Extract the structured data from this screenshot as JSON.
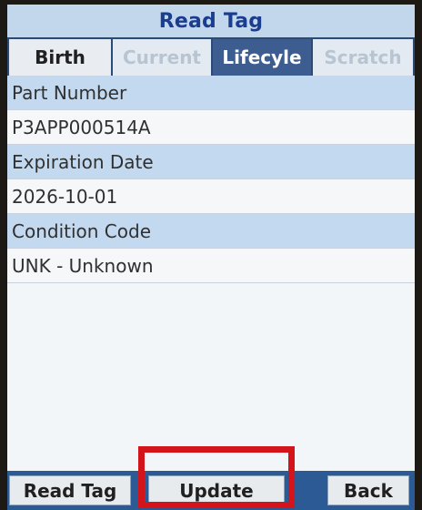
{
  "header": {
    "title": "Read Tag"
  },
  "tabs": [
    {
      "label": "Birth",
      "state": "normal"
    },
    {
      "label": "Current",
      "state": "disabled"
    },
    {
      "label": "Lifecyle",
      "state": "selected"
    },
    {
      "label": "Scratch",
      "state": "disabled"
    }
  ],
  "fields": [
    {
      "label": "Part Number",
      "value": "P3APP000514A"
    },
    {
      "label": "Expiration Date",
      "value": "2026-10-01"
    },
    {
      "label": "Condition Code",
      "value": "UNK - Unknown"
    }
  ],
  "footer": {
    "read_tag_label": "Read Tag",
    "update_label": "Update",
    "back_label": "Back"
  },
  "colors": {
    "title_text": "#1a3d8f",
    "label_row": "#c3d9f0",
    "selected_tab": "#3d5d90",
    "footer_bar": "#2c5a95",
    "highlight": "#d3151b"
  }
}
